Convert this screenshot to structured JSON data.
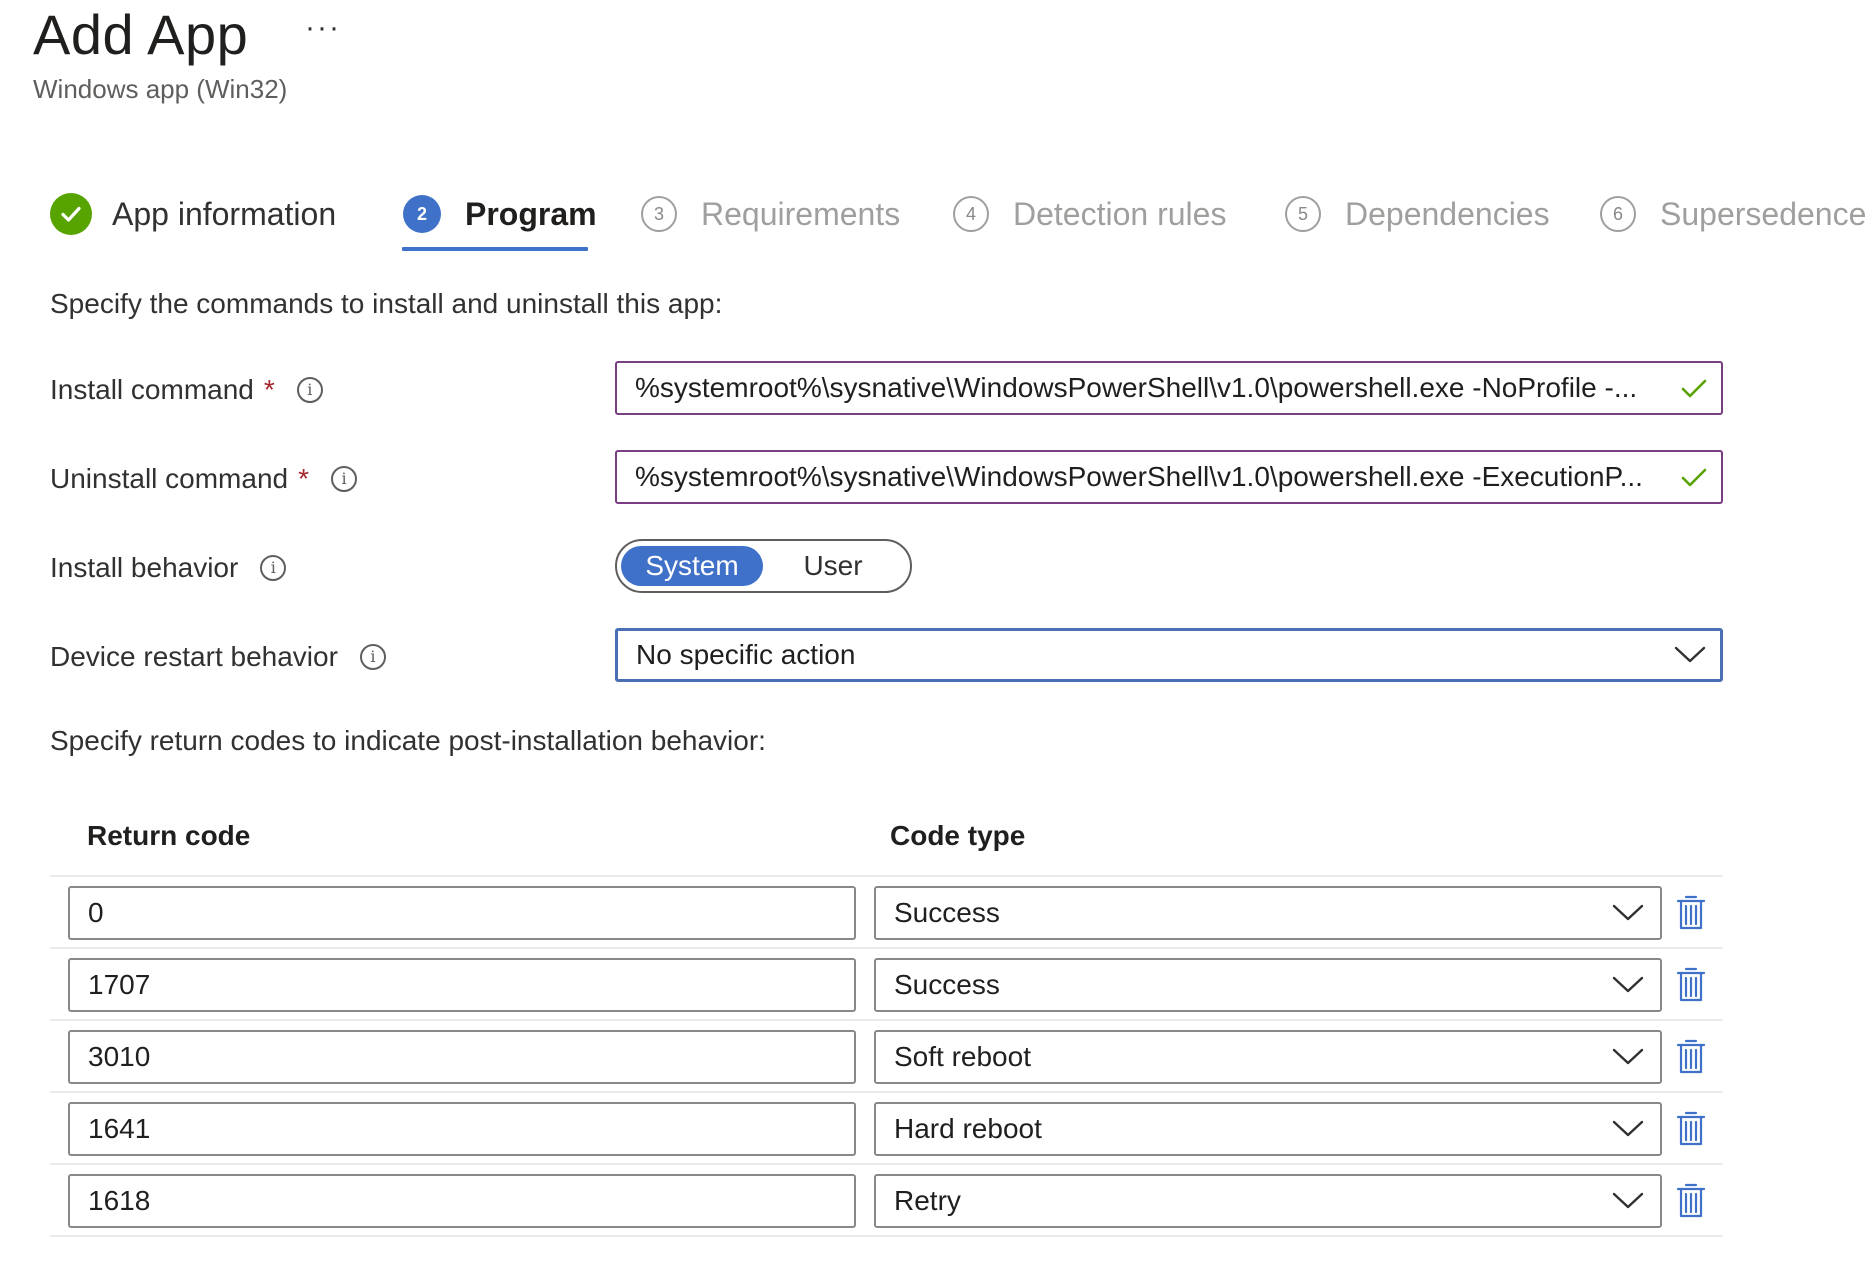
{
  "header": {
    "title": "Add App",
    "more_label": "···",
    "subtitle": "Windows app (Win32)"
  },
  "steps": [
    {
      "number": "",
      "label": "App information",
      "state": "done",
      "icon": "checkmark-icon"
    },
    {
      "number": "2",
      "label": "Program",
      "state": "active"
    },
    {
      "number": "3",
      "label": "Requirements",
      "state": "pending"
    },
    {
      "number": "4",
      "label": "Detection rules",
      "state": "pending"
    },
    {
      "number": "5",
      "label": "Dependencies",
      "state": "pending"
    },
    {
      "number": "6",
      "label": "Supersedence (",
      "state": "pending"
    }
  ],
  "program": {
    "intro": "Specify the commands to install and uninstall this app:",
    "install_command": {
      "label": "Install command",
      "required_mark": "*",
      "value": "%systemroot%\\sysnative\\WindowsPowerShell\\v1.0\\powershell.exe -NoProfile -..."
    },
    "uninstall_command": {
      "label": "Uninstall command",
      "required_mark": "*",
      "value": "%systemroot%\\sysnative\\WindowsPowerShell\\v1.0\\powershell.exe -ExecutionP..."
    },
    "install_behavior": {
      "label": "Install behavior",
      "options": [
        "System",
        "User"
      ],
      "selected": "System"
    },
    "restart_behavior": {
      "label": "Device restart behavior",
      "value": "No specific action"
    }
  },
  "return_codes": {
    "intro": "Specify return codes to indicate post-installation behavior:",
    "headers": {
      "code": "Return code",
      "type": "Code type"
    },
    "rows": [
      {
        "code": "0",
        "type": "Success"
      },
      {
        "code": "1707",
        "type": "Success"
      },
      {
        "code": "3010",
        "type": "Soft reboot"
      },
      {
        "code": "1641",
        "type": "Hard reboot"
      },
      {
        "code": "1618",
        "type": "Retry"
      }
    ]
  },
  "icons": {
    "info": "info-icon",
    "valid": "checkmark-icon",
    "dropdown": "chevron-down-icon",
    "delete": "trash-icon"
  },
  "colors": {
    "accent": "#3f71c9",
    "success": "#57a300",
    "required": "#a4262c",
    "valid_border": "#7a3f82"
  }
}
